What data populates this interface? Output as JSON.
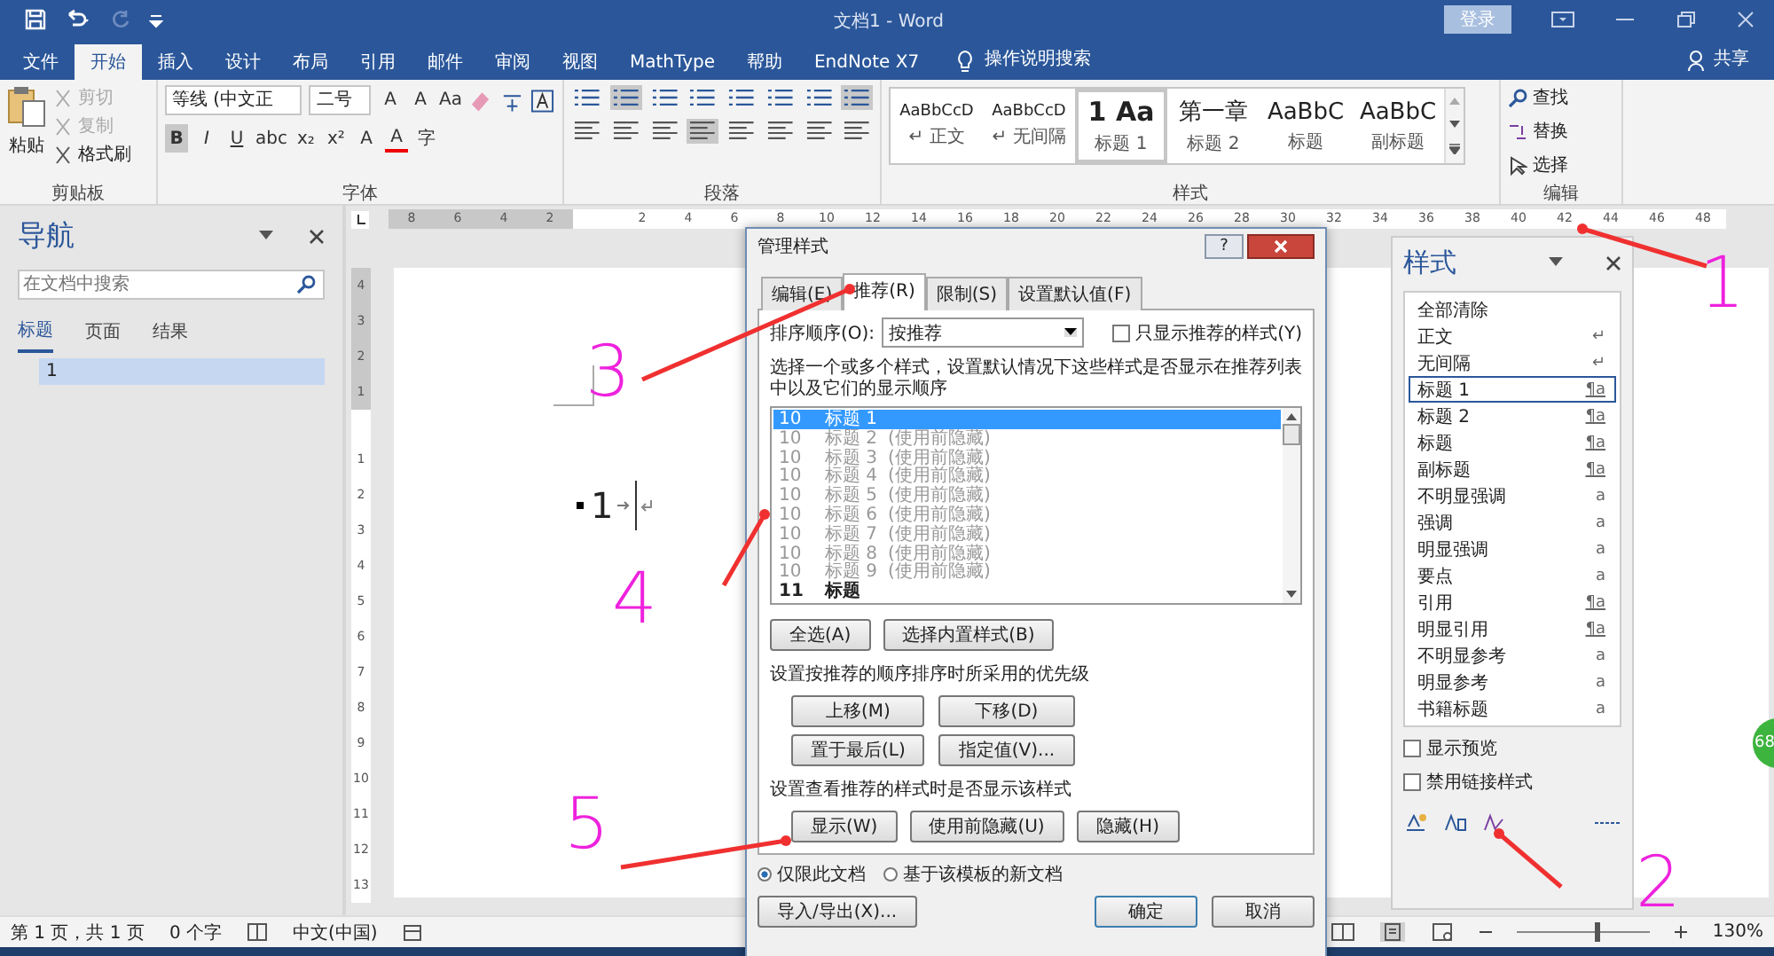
{
  "window": {
    "title": "文档1 - Word",
    "sign_in": "登录"
  },
  "menu_tabs": [
    {
      "label": "文件",
      "selected": false
    },
    {
      "label": "开始",
      "selected": true
    },
    {
      "label": "插入",
      "selected": false
    },
    {
      "label": "设计",
      "selected": false
    },
    {
      "label": "布局",
      "selected": false
    },
    {
      "label": "引用",
      "selected": false
    },
    {
      "label": "邮件",
      "selected": false
    },
    {
      "label": "审阅",
      "selected": false
    },
    {
      "label": "视图",
      "selected": false
    },
    {
      "label": "MathType",
      "selected": false
    },
    {
      "label": "帮助",
      "selected": false
    },
    {
      "label": "EndNote X7",
      "selected": false
    }
  ],
  "tell_me": "操作说明搜索",
  "share": "共享",
  "ribbon": {
    "clipboard": {
      "paste": "粘贴",
      "cut": {
        "label": "剪切",
        "disabled": true
      },
      "copy": {
        "label": "复制",
        "disabled": true
      },
      "format_painter": {
        "label": "格式刷",
        "disabled": false
      },
      "label": "剪贴板"
    },
    "font": {
      "name": "等线 (中文正",
      "size": "二号",
      "row1": [
        "A",
        "A",
        "Aa"
      ],
      "row2": [
        {
          "label": "B",
          "selected": true
        },
        {
          "label": "I",
          "selected": false
        },
        {
          "label": "U",
          "selected": false
        },
        {
          "label": "abc",
          "selected": false
        },
        {
          "label": "x₂",
          "selected": false
        },
        {
          "label": "x²",
          "selected": false
        },
        {
          "label": "A",
          "selected": false
        },
        {
          "label": "A",
          "selected": false
        },
        {
          "label": "字",
          "selected": false
        }
      ],
      "label": "字体"
    },
    "paragraph": {
      "label": "段落"
    },
    "styles": {
      "items": [
        {
          "preview": "AaBbCcD",
          "name": "↵ 正文",
          "selected": false,
          "kind": "plain"
        },
        {
          "preview": "AaBbCcD",
          "name": "↵ 无间隔",
          "selected": false,
          "kind": "plain"
        },
        {
          "preview": "1 Aa",
          "name": "标题 1",
          "selected": true,
          "kind": "heading"
        },
        {
          "preview": "第一章",
          "name": "标题 2",
          "selected": false,
          "kind": "chapter"
        },
        {
          "preview": "AaBbC",
          "name": "标题",
          "selected": false,
          "kind": "title"
        },
        {
          "preview": "AaBbC",
          "name": "副标题",
          "selected": false,
          "kind": "title"
        }
      ],
      "label": "样式"
    },
    "editing": {
      "find": "查找",
      "replace": "替换",
      "select": "选择",
      "label": "编辑"
    }
  },
  "ruler": {
    "horizontal": [
      "8",
      "6",
      "4",
      "2",
      "2",
      "4",
      "6",
      "8",
      "10",
      "12",
      "14",
      "16",
      "18",
      "20",
      "22",
      "24",
      "26",
      "28",
      "30",
      "32",
      "34",
      "36",
      "38",
      "40",
      "42",
      "44",
      "46",
      "48"
    ],
    "vertical": [
      "4",
      "3",
      "2",
      "1",
      "1",
      "2",
      "3",
      "4",
      "5",
      "6",
      "7",
      "8",
      "9",
      "10",
      "11",
      "12",
      "13"
    ]
  },
  "navigation": {
    "title": "导航",
    "search_placeholder": "在文档中搜索",
    "tabs": [
      {
        "label": "标题",
        "selected": true
      },
      {
        "label": "页面",
        "selected": false
      },
      {
        "label": "结果",
        "selected": false
      }
    ],
    "headings": [
      {
        "label": "1",
        "selected": true
      }
    ]
  },
  "document": {
    "heading": "1"
  },
  "dialog": {
    "title": "管理样式",
    "help": "?",
    "tabs": [
      {
        "label": "编辑(E)",
        "selected": false
      },
      {
        "label": "推荐(R)",
        "selected": true
      },
      {
        "label": "限制(S)",
        "selected": false
      },
      {
        "label": "设置默认值(F)",
        "selected": false
      }
    ],
    "sort_label": "排序顺序(O):",
    "sort_value": "按推荐",
    "only_recommended": {
      "label": "只显示推荐的样式(Y)",
      "checked": false
    },
    "description": "选择一个或多个样式，设置默认情况下这些样式是否显示在推荐列表中以及它们的显示顺序",
    "styles": [
      {
        "priority": "10",
        "name": "标题 1",
        "selected": true,
        "hidden": false
      },
      {
        "priority": "10",
        "name": "标题 2",
        "note": "(使用前隐藏)",
        "selected": false,
        "hidden": true
      },
      {
        "priority": "10",
        "name": "标题 3",
        "note": "(使用前隐藏)",
        "selected": false,
        "hidden": true
      },
      {
        "priority": "10",
        "name": "标题 4",
        "note": "(使用前隐藏)",
        "selected": false,
        "hidden": true
      },
      {
        "priority": "10",
        "name": "标题 5",
        "note": "(使用前隐藏)",
        "selected": false,
        "hidden": true
      },
      {
        "priority": "10",
        "name": "标题 6",
        "note": "(使用前隐藏)",
        "selected": false,
        "hidden": true
      },
      {
        "priority": "10",
        "name": "标题 7",
        "note": "(使用前隐藏)",
        "selected": false,
        "hidden": true
      },
      {
        "priority": "10",
        "name": "标题 8",
        "note": "(使用前隐藏)",
        "selected": false,
        "hidden": true
      },
      {
        "priority": "10",
        "name": "标题 9",
        "note": "(使用前隐藏)",
        "selected": false,
        "hidden": true
      },
      {
        "priority": "11",
        "name": "标题",
        "selected": false,
        "hidden": false
      }
    ],
    "select_buttons": [
      "全选(A)",
      "选择内置样式(B)"
    ],
    "priority_label": "设置按推荐的顺序排序时所采用的优先级",
    "priority_buttons": [
      "上移(M)",
      "下移(D)",
      "置于最后(L)",
      "指定值(V)..."
    ],
    "visibility_label": "设置查看推荐的样式时是否显示该样式",
    "visibility_buttons": [
      "显示(W)",
      "使用前隐藏(U)",
      "隐藏(H)"
    ],
    "scope": [
      {
        "label": "仅限此文档",
        "selected": true
      },
      {
        "label": "基于该模板的新文档",
        "selected": false
      }
    ],
    "import_export": "导入/导出(X)...",
    "ok": "确定",
    "cancel": "取消"
  },
  "styles_pane": {
    "title": "样式",
    "items": [
      {
        "name": "全部清除",
        "selected": false
      },
      {
        "name": "正文",
        "mark": "↵",
        "kind": "paragraph",
        "selected": false
      },
      {
        "name": "无间隔",
        "mark": "↵",
        "kind": "paragraph",
        "selected": false
      },
      {
        "name": "标题 1",
        "mark": "¶a",
        "kind": "linked",
        "selected": true
      },
      {
        "name": "标题 2",
        "mark": "¶a",
        "kind": "linked",
        "selected": false
      },
      {
        "name": "标题",
        "mark": "¶a",
        "kind": "linked",
        "selected": false
      },
      {
        "name": "副标题",
        "mark": "¶a",
        "kind": "linked",
        "selected": false
      },
      {
        "name": "不明显强调",
        "mark": "a",
        "kind": "character",
        "selected": false
      },
      {
        "name": "强调",
        "mark": "a",
        "kind": "character",
        "selected": false
      },
      {
        "name": "明显强调",
        "mark": "a",
        "kind": "character",
        "selected": false
      },
      {
        "name": "要点",
        "mark": "a",
        "kind": "character",
        "selected": false
      },
      {
        "name": "引用",
        "mark": "¶a",
        "kind": "linked",
        "selected": false
      },
      {
        "name": "明显引用",
        "mark": "¶a",
        "kind": "linked",
        "selected": false
      },
      {
        "name": "不明显参考",
        "mark": "a",
        "kind": "character",
        "selected": false
      },
      {
        "name": "明显参考",
        "mark": "a",
        "kind": "character",
        "selected": false
      },
      {
        "name": "书籍标题",
        "mark": "a",
        "kind": "character",
        "selected": false
      }
    ],
    "options": [
      {
        "label": "显示预览",
        "checked": false
      },
      {
        "label": "禁用链接样式",
        "checked": false
      }
    ]
  },
  "status_bar": {
    "page": "第 1 页，共 1 页",
    "words": "0 个字",
    "language": "中文(中国)",
    "zoom": "130%",
    "zoom_slider": {
      "level": 0.6
    }
  },
  "badge": "68",
  "annotations": [
    "3",
    "4",
    "5",
    "1",
    "2"
  ]
}
